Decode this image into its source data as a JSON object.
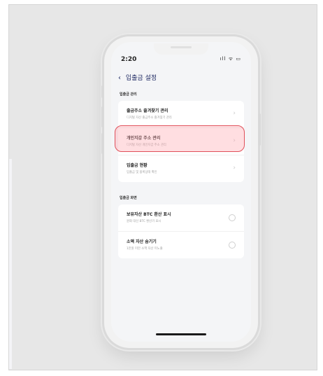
{
  "status_bar": {
    "time": "2:20",
    "icons": "ıll ᯤ ▭"
  },
  "nav": {
    "back_icon": "‹",
    "title": "입출금 설정"
  },
  "sections": [
    {
      "label": "입출금 관리",
      "items": [
        {
          "title": "출금주소 즐겨찾기 관리",
          "subtitle": "디지털 자산 출금주소 즐겨찾기 관리",
          "control": "chevron",
          "highlighted": false
        },
        {
          "title": "개인지갑 주소 관리",
          "subtitle": "디지털 자산 개인지갑 주소 관리",
          "control": "chevron",
          "highlighted": true
        },
        {
          "title": "입출금 현황",
          "subtitle": "입출금 및 블록상태 확인",
          "control": "chevron",
          "highlighted": false
        }
      ]
    },
    {
      "label": "입출금 화면",
      "items": [
        {
          "title": "보유자산 BTC 환산 표시",
          "subtitle": "원화 대신 BTC 환산가 표시",
          "control": "radio",
          "selected": false
        },
        {
          "title": "소액 자산 숨기기",
          "subtitle": "1만원 미만 소액 자산 미노출",
          "control": "radio",
          "selected": false
        }
      ]
    }
  ],
  "icons": {
    "chevron": "›"
  },
  "colors": {
    "highlight_border": "#e0505a",
    "highlight_fill": "#ffd9dd",
    "nav_text": "#1f2a63",
    "screen_bg": "#f4f5f7"
  }
}
